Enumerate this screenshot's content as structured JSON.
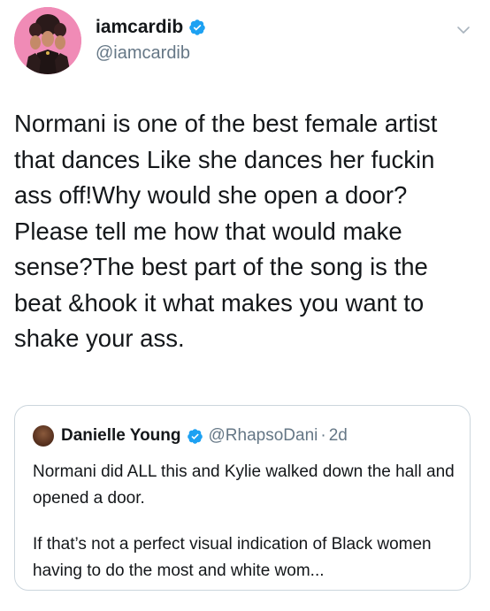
{
  "author": {
    "display_name": "iamcardib",
    "handle": "@iamcardib",
    "avatar_icon": "profile-avatar",
    "verified_icon": "verified-badge-icon",
    "accent_color": "#1da1f2"
  },
  "tweet": {
    "text": "Normani is one of the best female artist that dances Like she dances her fuckin ass off!Why would she open a door? Please tell me how that would make sense?The best part of the song is the beat &hook  it what makes you want to shake your ass."
  },
  "menu": {
    "icon": "chevron-down-icon"
  },
  "quoted_tweet": {
    "display_name": "Danielle Young",
    "handle": "@RhapsoDani",
    "separator": "·",
    "time": "2d",
    "paragraph_1": "Normani did ALL this and Kylie walked down the hall and opened a door.",
    "paragraph_2": "If that’s not a perfect visual indication of Black women having to do the most and white wom..."
  }
}
